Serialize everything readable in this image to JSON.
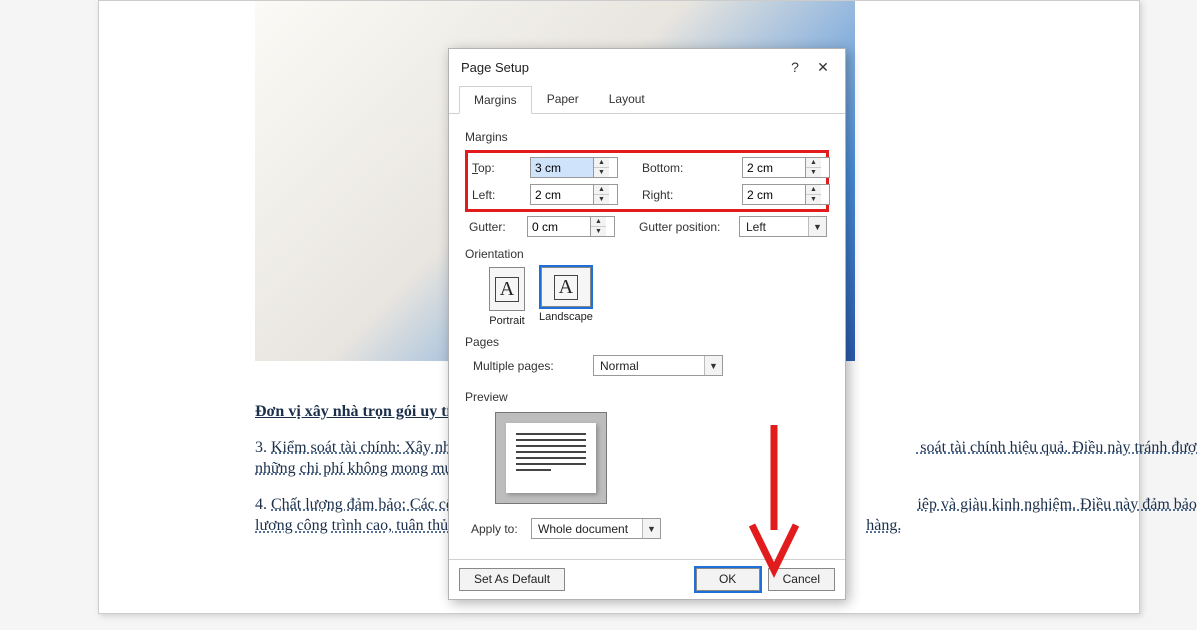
{
  "document": {
    "title": "Đơn vị xây nhà trọn gói uy tín tại Hà N",
    "para1_a": "3. ",
    "para1_b": "Kiểm soát tài chính: Xây nhà trọn gói ",
    "para1_c": " soát tài chính hiệu quả. Điều này tránh được những chi phí không mong muốn ha",
    "para2_a": "4. ",
    "para2_b": "Chất lượng đảm bảo: Các công ty xây ",
    "para2_c": "iệp và giàu kinh nghiệm. Điều này đảm bảo chất lượng công trình cao, tuân thủ cá",
    "para2_d": "hàng."
  },
  "dialog": {
    "title": "Page Setup",
    "tabs": {
      "margins": "Margins",
      "paper": "Paper",
      "layout": "Layout"
    },
    "sections": {
      "margins": "Margins",
      "orientation": "Orientation",
      "pages": "Pages",
      "preview": "Preview"
    },
    "labels": {
      "top": "Top:",
      "bottom": "Bottom:",
      "left": "Left:",
      "right": "Right:",
      "gutter": "Gutter:",
      "gutterpos": "Gutter position:",
      "multiple": "Multiple pages:",
      "applyto": "Apply to:"
    },
    "values": {
      "top": "3 cm",
      "bottom": "2 cm",
      "left": "2 cm",
      "right": "2 cm",
      "gutter": "0 cm",
      "gutterpos": "Left",
      "multiple": "Normal",
      "applyto": "Whole document"
    },
    "orientation": {
      "portrait": "Portrait",
      "landscape": "Landscape",
      "selected": "landscape"
    },
    "buttons": {
      "setdefault": "Set As Default",
      "ok": "OK",
      "cancel": "Cancel"
    }
  }
}
